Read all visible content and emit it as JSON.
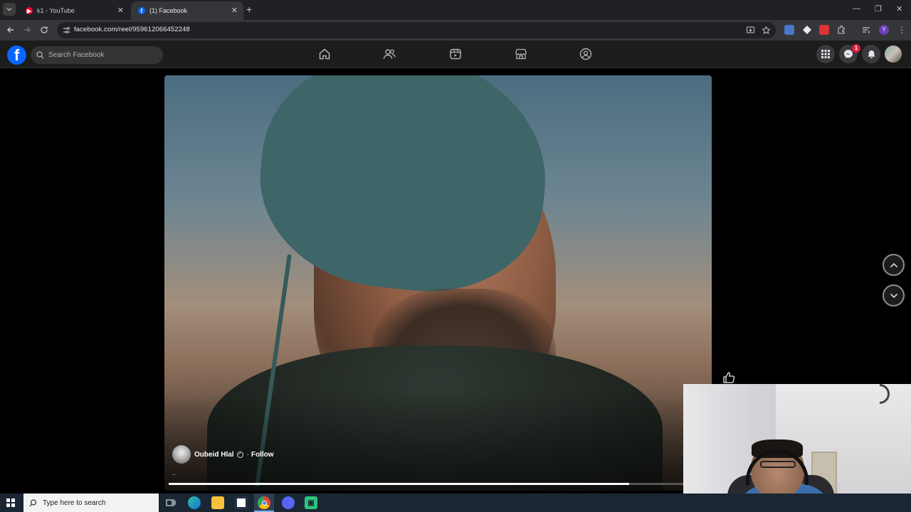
{
  "browser": {
    "tabs": [
      {
        "title": "k1 - YouTube",
        "favicon": "youtube-icon",
        "active": false
      },
      {
        "title": "(1) Facebook",
        "favicon": "facebook-icon",
        "active": true
      }
    ],
    "url": "facebook.com/reel/959612066452248"
  },
  "facebook": {
    "logo": "f",
    "search_placeholder": "Search Facebook",
    "nav_icons": [
      "home-icon",
      "friends-icon",
      "watch-icon",
      "marketplace-icon",
      "groups-icon"
    ],
    "right_icons": [
      "menu-grid-icon",
      "messenger-icon",
      "notifications-icon",
      "profile-avatar"
    ],
    "messenger_badge": "1",
    "brand_color": "#0866ff"
  },
  "reel": {
    "creator_name": "Oubeid Hlal",
    "separator": "·",
    "follow_label": "Follow",
    "caption": "..",
    "progress": 0.855
  },
  "taskbar": {
    "search_placeholder": "Type here to search",
    "pinned": [
      "task-view-icon",
      "edge-icon",
      "file-explorer-icon",
      "store-icon",
      "chrome-icon",
      "discord-icon",
      "app-icon"
    ]
  }
}
